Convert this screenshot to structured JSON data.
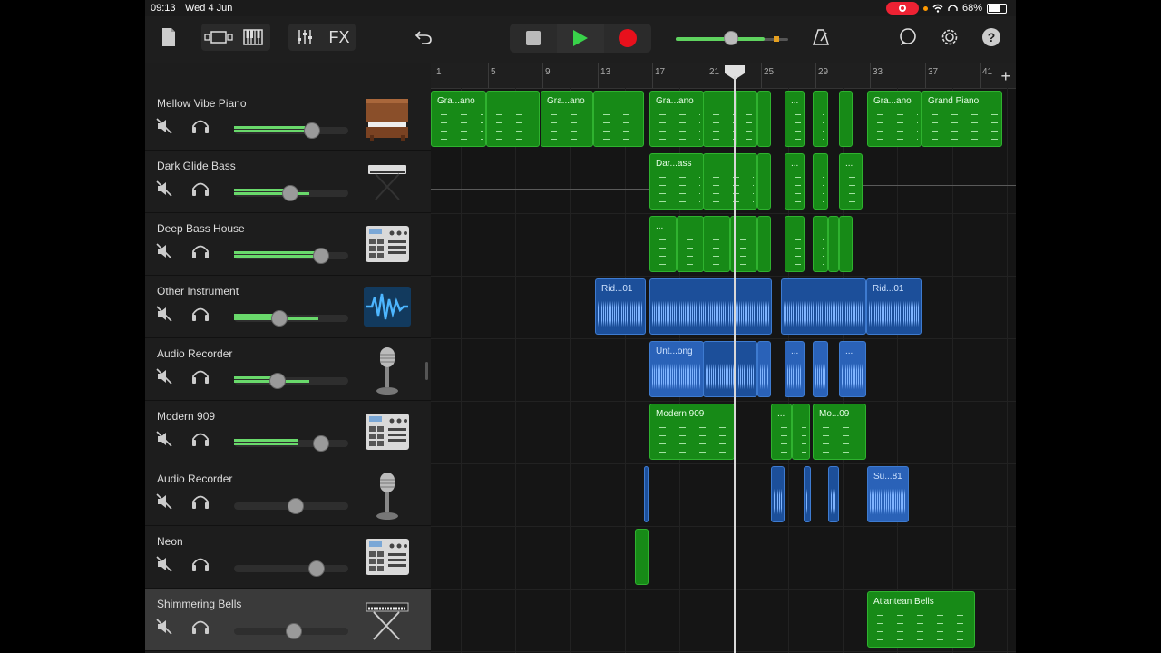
{
  "status": {
    "time": "09:13",
    "date": "Wed 4 Jun",
    "battery": "68%"
  },
  "toolbar": {
    "fx_label": "FX",
    "help_label": "?"
  },
  "ruler": {
    "bars": [
      "1",
      "5",
      "9",
      "13",
      "17",
      "21",
      "25",
      "29",
      "33",
      "37",
      "41"
    ]
  },
  "tracks": [
    {
      "name": "Mellow Vibe Piano",
      "volume": 0.68,
      "level": 0.66,
      "level2": 0.62,
      "instrument": "piano"
    },
    {
      "name": "Dark Glide Bass",
      "volume": 0.49,
      "level": 0.66,
      "level2": 0.48,
      "instrument": "synth-keyboard"
    },
    {
      "name": "Deep Bass House",
      "volume": 0.76,
      "level": 0.74,
      "level2": 0.74,
      "instrument": "drum-machine"
    },
    {
      "name": "Other Instrument",
      "volume": 0.4,
      "level": 0.74,
      "level2": 0.4,
      "instrument": "waveform"
    },
    {
      "name": "Audio Recorder",
      "volume": 0.38,
      "level": 0.66,
      "level2": 0.38,
      "instrument": "microphone"
    },
    {
      "name": "Modern 909",
      "volume": 0.76,
      "level": 0.56,
      "level2": 0.56,
      "instrument": "drum-machine"
    },
    {
      "name": "Audio Recorder",
      "volume": 0.54,
      "level": 0,
      "level2": 0,
      "instrument": "microphone"
    },
    {
      "name": "Neon",
      "volume": 0.72,
      "level": 0,
      "level2": 0,
      "instrument": "drum-machine"
    },
    {
      "name": "Shimmering Bells",
      "volume": 0.52,
      "level": 0,
      "level2": 0,
      "instrument": "keyboard-stand",
      "selected": true
    }
  ],
  "regions": {
    "r0a": "Gra...ano",
    "r0b": "Gra...ano",
    "r0c": "Gra...ano",
    "r0d": "...",
    "r0e": "Gra...ano",
    "r0f": "Grand Piano",
    "r1a": "Dar...ass",
    "r1b": "...",
    "r1c": "...",
    "r2a": "...",
    "r3a": "Rid...01",
    "r3b": "Rid...01",
    "r4a": "Unt...ong",
    "r4b": "...",
    "r4c": "...",
    "r5a": "Modern 909",
    "r5b": "...",
    "r5c": "Mo...09",
    "r6a": "Su...81",
    "r8a": "Atlantean Bells"
  },
  "colors": {
    "midi": "#178a17",
    "audio": "#1c4f9a",
    "play": "#39d24a",
    "record": "#e8101c",
    "meter": "#69d96b"
  }
}
